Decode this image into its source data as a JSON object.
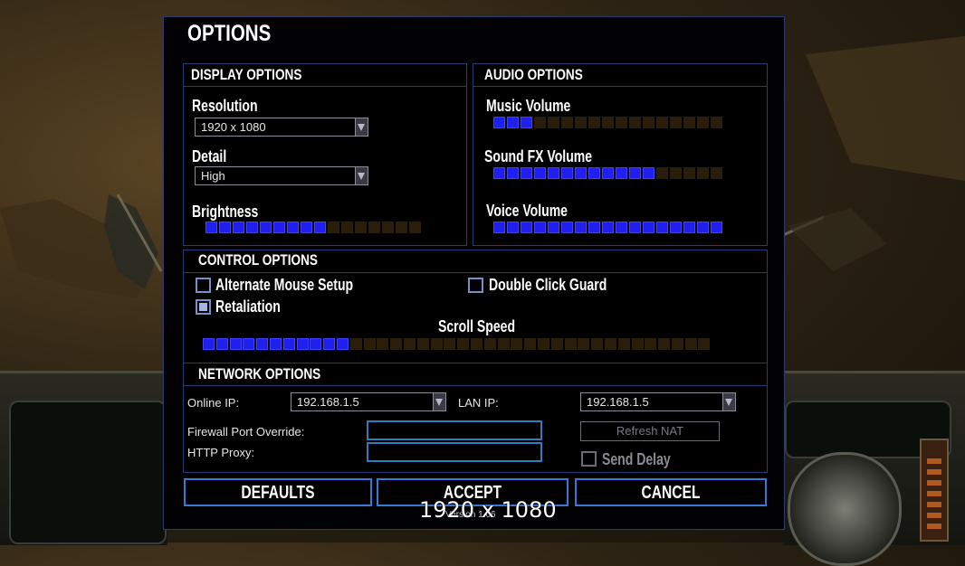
{
  "dialog": {
    "title": "OPTIONS"
  },
  "display_options": {
    "title": "DISPLAY OPTIONS",
    "resolution": {
      "label": "Resolution",
      "value": "1920 x 1080"
    },
    "detail": {
      "label": "Detail",
      "value": "High"
    },
    "brightness": {
      "label": "Brightness",
      "level": 9,
      "segments": 16
    }
  },
  "audio_options": {
    "title": "AUDIO OPTIONS",
    "music": {
      "label": "Music Volume",
      "level": 3,
      "segments": 17
    },
    "sfx": {
      "label": "Sound FX Volume",
      "level": 12,
      "segments": 17
    },
    "voice": {
      "label": "Voice Volume",
      "level": 17,
      "segments": 17
    }
  },
  "control_options": {
    "title": "CONTROL OPTIONS",
    "alternate_mouse": {
      "label": "Alternate Mouse Setup",
      "checked": false
    },
    "double_click_guard": {
      "label": "Double Click Guard",
      "checked": false
    },
    "retaliation": {
      "label": "Retaliation",
      "checked": true
    },
    "scroll_speed": {
      "label": "Scroll Speed",
      "level": 11,
      "segments": 38
    }
  },
  "network_options": {
    "title": "NETWORK OPTIONS",
    "online_ip": {
      "label": "Online IP:",
      "value": "192.168.1.5"
    },
    "lan_ip": {
      "label": "LAN IP:",
      "value": "192.168.1.5"
    },
    "firewall_port": {
      "label": "Firewall Port Override:",
      "value": ""
    },
    "http_proxy": {
      "label": "HTTP Proxy:",
      "value": ""
    },
    "refresh_nat": {
      "label": "Refresh NAT"
    },
    "send_delay": {
      "label": "Send Delay",
      "checked": false
    }
  },
  "buttons": {
    "defaults": "DEFAULTS",
    "accept": "ACCEPT",
    "cancel": "CANCEL"
  },
  "version": "Version 1.06",
  "overlay_resolution": "1920 x 1080",
  "colors": {
    "slider_on": "#2020ee",
    "slider_off": "#2a1e0a",
    "border": "#2b3c6e",
    "button_border": "#3a78d8"
  }
}
